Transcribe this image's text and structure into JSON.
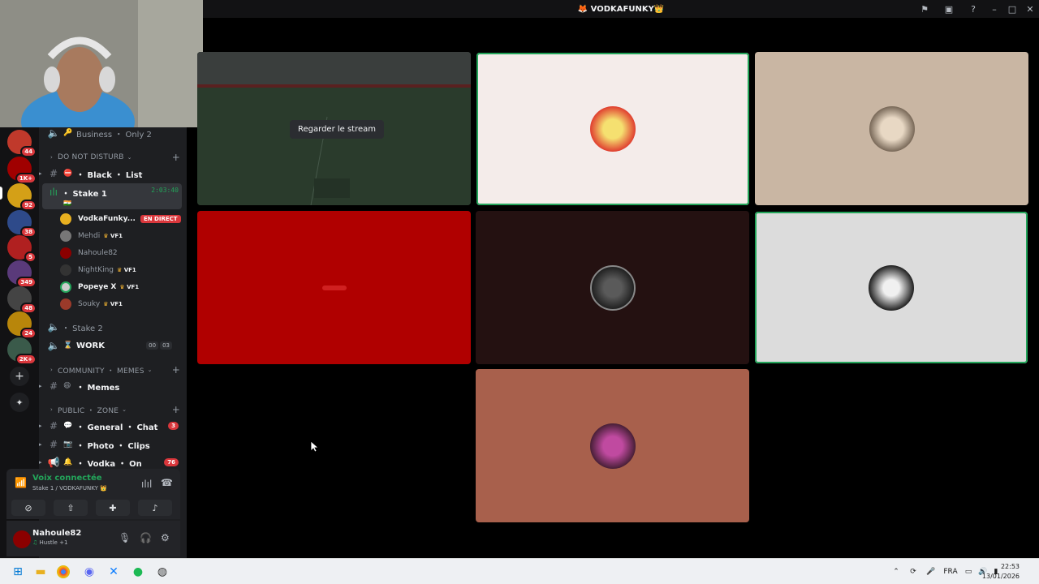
{
  "window": {
    "title": "VODKAFUNKY",
    "title_emoji": "👑"
  },
  "rail": {
    "servers": [
      {
        "badge": "44",
        "color": "#c0392b"
      },
      {
        "badge": "1K+",
        "color": "#a00000"
      },
      {
        "badge": "92",
        "color": "#d4a017"
      },
      {
        "badge": "38",
        "color": "#2e4a8a"
      },
      {
        "badge": "5",
        "color": "#b02020"
      },
      {
        "badge": "349",
        "color": "#5a3a7a"
      },
      {
        "badge": "48",
        "color": "#444444"
      },
      {
        "badge": "24",
        "color": "#b8860b"
      },
      {
        "badge": "2K+",
        "color": "#3a5a4a"
      }
    ],
    "add_server": "+",
    "explore": "✦"
  },
  "sidebar": {
    "top_channel": {
      "name": "Business ・ Only 2",
      "emoji": "🔑"
    },
    "categories": [
      {
        "label": "DO NOT DISTURB"
      },
      {
        "label": "COMMUNITY ・ MEMES"
      },
      {
        "label": "PUBLIC ・ ZONE"
      }
    ],
    "channels": {
      "black_list": "・ Black ・ List",
      "stake1": "・ Stake 1",
      "stake1_timer": "2:03:40",
      "stake2": "・ Stake 2",
      "work": "WORK",
      "work_counter": [
        "00",
        "03"
      ],
      "memes": "・ Memes",
      "general": "・ General ・ Chat",
      "general_badge": "3",
      "photo": "・ Photo ・ Clips",
      "vodka": "・ Vodka ・ On",
      "vodka_badge": "76"
    },
    "voice_users": [
      {
        "name": "VodkaFunky...",
        "live": true,
        "live_label": "EN DIRECT",
        "tag": "",
        "color": "#e8b020"
      },
      {
        "name": "Mehdi",
        "live": false,
        "tag": "VF1",
        "color": "#777777"
      },
      {
        "name": "Nahoule82",
        "live": false,
        "tag": "",
        "color": "#8b0000"
      },
      {
        "name": "NightKing",
        "live": false,
        "tag": "VF1",
        "color": "#333333"
      },
      {
        "name": "Popeye X",
        "live": true,
        "tag": "VF1",
        "color": "#cccccc"
      },
      {
        "name": "Souky",
        "live": false,
        "tag": "VF1",
        "color": "#9b3a2a"
      }
    ]
  },
  "voice_panel": {
    "status": "Voix connectée",
    "location": "Stake 1 / VODKAFUNKY"
  },
  "user_panel": {
    "username": "Nahoule82",
    "status": "Hustle +1"
  },
  "stream": {
    "watch_label": "Regarder le stream"
  },
  "taskbar": {
    "language": "FRA",
    "time": "22:53",
    "date": "13/01/2026"
  }
}
